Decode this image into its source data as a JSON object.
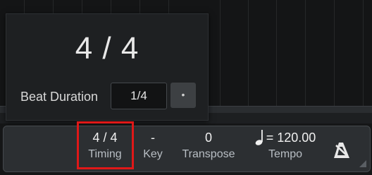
{
  "popup": {
    "time_signature": "4 / 4",
    "beat_duration_label": "Beat Duration",
    "beat_duration_value": "1/4",
    "dot_button": "•"
  },
  "bar": {
    "timing": {
      "value": "4 / 4",
      "label": "Timing"
    },
    "key": {
      "value": "-",
      "label": "Key"
    },
    "transpose": {
      "value": "0",
      "label": "Transpose"
    },
    "tempo": {
      "value": "= 120.00",
      "label": "Tempo"
    }
  },
  "icons": {
    "note": "quarter-note-icon",
    "metronome": "metronome-icon",
    "highlight_color": "#e01818"
  }
}
